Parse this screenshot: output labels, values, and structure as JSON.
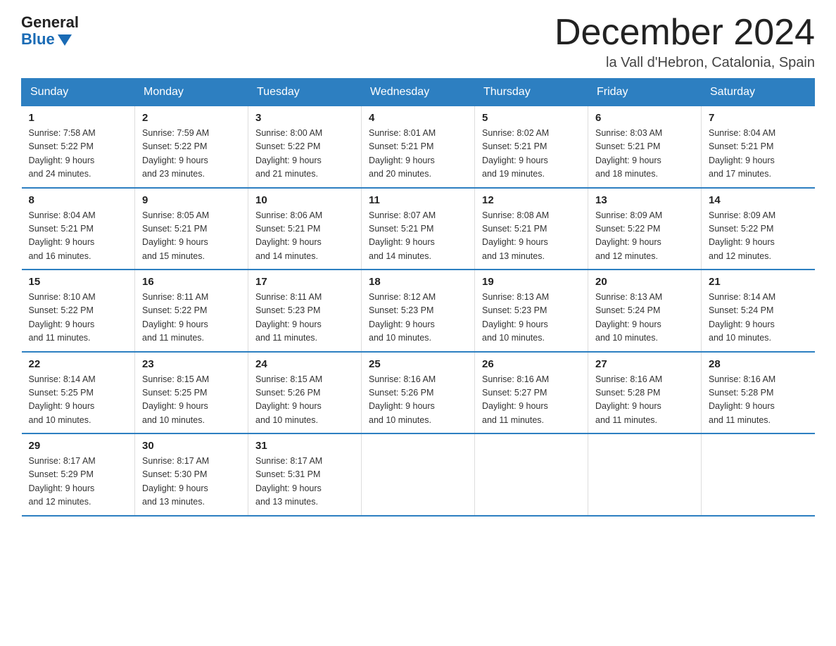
{
  "header": {
    "logo_general": "General",
    "logo_blue": "Blue",
    "month_title": "December 2024",
    "location": "la Vall d'Hebron, Catalonia, Spain"
  },
  "weekdays": [
    "Sunday",
    "Monday",
    "Tuesday",
    "Wednesday",
    "Thursday",
    "Friday",
    "Saturday"
  ],
  "weeks": [
    [
      {
        "day": "1",
        "sunrise": "7:58 AM",
        "sunset": "5:22 PM",
        "daylight": "9 hours and 24 minutes."
      },
      {
        "day": "2",
        "sunrise": "7:59 AM",
        "sunset": "5:22 PM",
        "daylight": "9 hours and 23 minutes."
      },
      {
        "day": "3",
        "sunrise": "8:00 AM",
        "sunset": "5:22 PM",
        "daylight": "9 hours and 21 minutes."
      },
      {
        "day": "4",
        "sunrise": "8:01 AM",
        "sunset": "5:21 PM",
        "daylight": "9 hours and 20 minutes."
      },
      {
        "day": "5",
        "sunrise": "8:02 AM",
        "sunset": "5:21 PM",
        "daylight": "9 hours and 19 minutes."
      },
      {
        "day": "6",
        "sunrise": "8:03 AM",
        "sunset": "5:21 PM",
        "daylight": "9 hours and 18 minutes."
      },
      {
        "day": "7",
        "sunrise": "8:04 AM",
        "sunset": "5:21 PM",
        "daylight": "9 hours and 17 minutes."
      }
    ],
    [
      {
        "day": "8",
        "sunrise": "8:04 AM",
        "sunset": "5:21 PM",
        "daylight": "9 hours and 16 minutes."
      },
      {
        "day": "9",
        "sunrise": "8:05 AM",
        "sunset": "5:21 PM",
        "daylight": "9 hours and 15 minutes."
      },
      {
        "day": "10",
        "sunrise": "8:06 AM",
        "sunset": "5:21 PM",
        "daylight": "9 hours and 14 minutes."
      },
      {
        "day": "11",
        "sunrise": "8:07 AM",
        "sunset": "5:21 PM",
        "daylight": "9 hours and 14 minutes."
      },
      {
        "day": "12",
        "sunrise": "8:08 AM",
        "sunset": "5:21 PM",
        "daylight": "9 hours and 13 minutes."
      },
      {
        "day": "13",
        "sunrise": "8:09 AM",
        "sunset": "5:22 PM",
        "daylight": "9 hours and 12 minutes."
      },
      {
        "day": "14",
        "sunrise": "8:09 AM",
        "sunset": "5:22 PM",
        "daylight": "9 hours and 12 minutes."
      }
    ],
    [
      {
        "day": "15",
        "sunrise": "8:10 AM",
        "sunset": "5:22 PM",
        "daylight": "9 hours and 11 minutes."
      },
      {
        "day": "16",
        "sunrise": "8:11 AM",
        "sunset": "5:22 PM",
        "daylight": "9 hours and 11 minutes."
      },
      {
        "day": "17",
        "sunrise": "8:11 AM",
        "sunset": "5:23 PM",
        "daylight": "9 hours and 11 minutes."
      },
      {
        "day": "18",
        "sunrise": "8:12 AM",
        "sunset": "5:23 PM",
        "daylight": "9 hours and 10 minutes."
      },
      {
        "day": "19",
        "sunrise": "8:13 AM",
        "sunset": "5:23 PM",
        "daylight": "9 hours and 10 minutes."
      },
      {
        "day": "20",
        "sunrise": "8:13 AM",
        "sunset": "5:24 PM",
        "daylight": "9 hours and 10 minutes."
      },
      {
        "day": "21",
        "sunrise": "8:14 AM",
        "sunset": "5:24 PM",
        "daylight": "9 hours and 10 minutes."
      }
    ],
    [
      {
        "day": "22",
        "sunrise": "8:14 AM",
        "sunset": "5:25 PM",
        "daylight": "9 hours and 10 minutes."
      },
      {
        "day": "23",
        "sunrise": "8:15 AM",
        "sunset": "5:25 PM",
        "daylight": "9 hours and 10 minutes."
      },
      {
        "day": "24",
        "sunrise": "8:15 AM",
        "sunset": "5:26 PM",
        "daylight": "9 hours and 10 minutes."
      },
      {
        "day": "25",
        "sunrise": "8:16 AM",
        "sunset": "5:26 PM",
        "daylight": "9 hours and 10 minutes."
      },
      {
        "day": "26",
        "sunrise": "8:16 AM",
        "sunset": "5:27 PM",
        "daylight": "9 hours and 11 minutes."
      },
      {
        "day": "27",
        "sunrise": "8:16 AM",
        "sunset": "5:28 PM",
        "daylight": "9 hours and 11 minutes."
      },
      {
        "day": "28",
        "sunrise": "8:16 AM",
        "sunset": "5:28 PM",
        "daylight": "9 hours and 11 minutes."
      }
    ],
    [
      {
        "day": "29",
        "sunrise": "8:17 AM",
        "sunset": "5:29 PM",
        "daylight": "9 hours and 12 minutes."
      },
      {
        "day": "30",
        "sunrise": "8:17 AM",
        "sunset": "5:30 PM",
        "daylight": "9 hours and 13 minutes."
      },
      {
        "day": "31",
        "sunrise": "8:17 AM",
        "sunset": "5:31 PM",
        "daylight": "9 hours and 13 minutes."
      },
      null,
      null,
      null,
      null
    ]
  ]
}
